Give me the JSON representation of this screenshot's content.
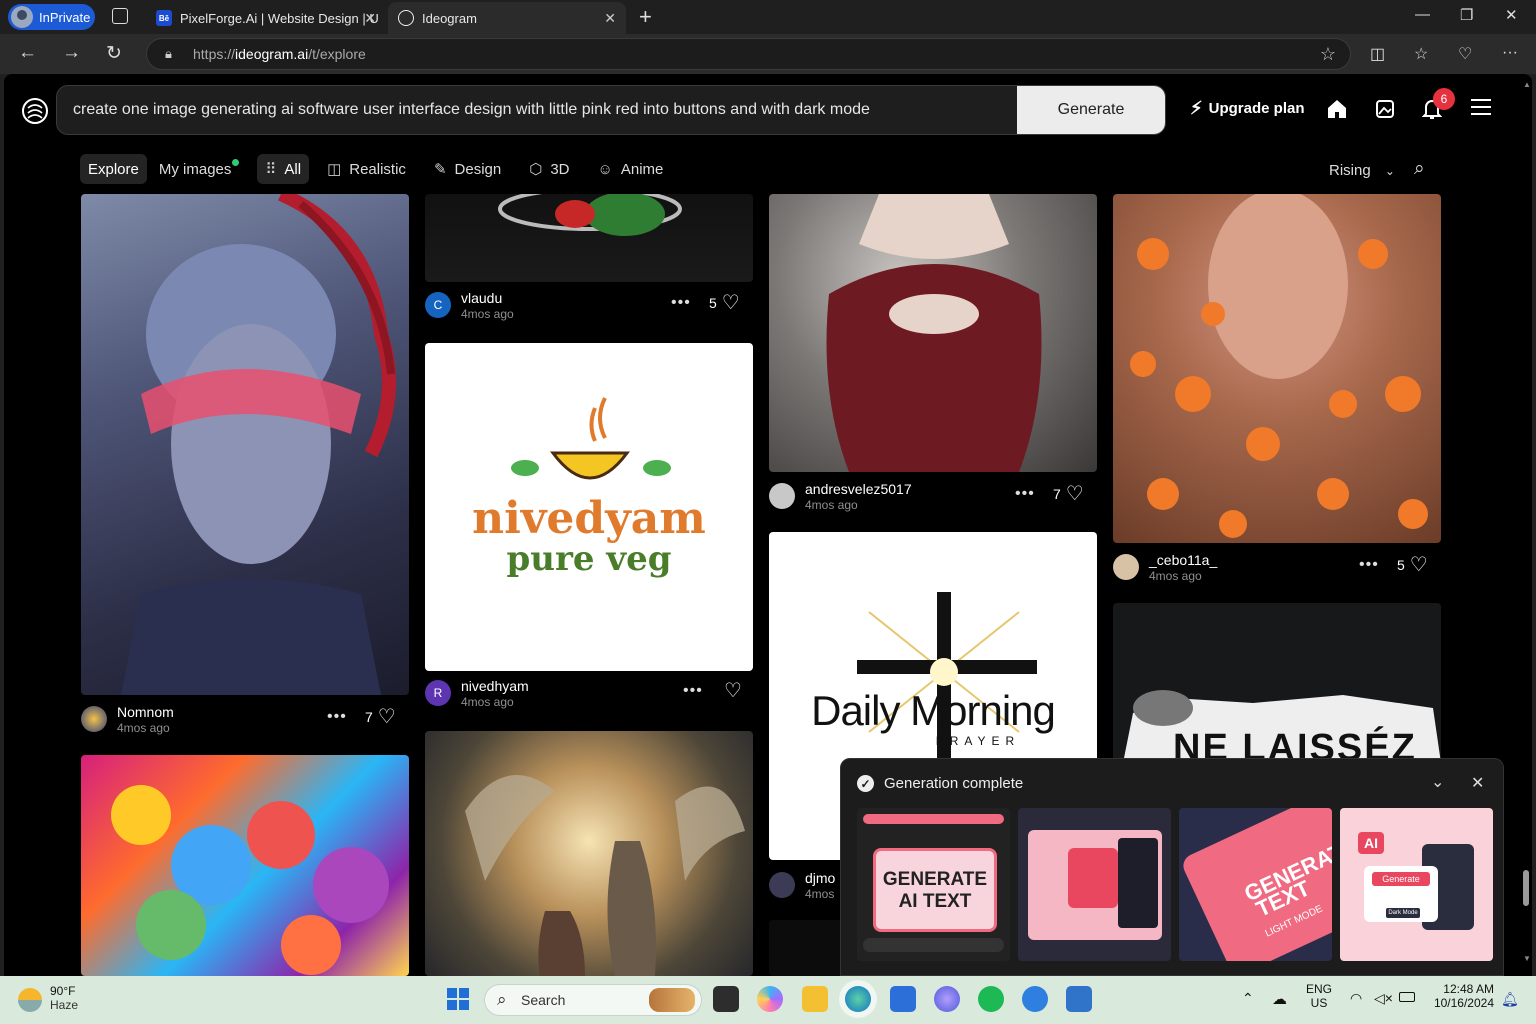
{
  "browser": {
    "inprivate_label": "InPrivate",
    "tabs": [
      {
        "title": "PixelForge.Ai | Website Design | U",
        "favicon": "Bē"
      },
      {
        "title": "Ideogram"
      }
    ],
    "url_prefix": "https://",
    "url_domain": "ideogram.ai",
    "url_path": "/t/explore"
  },
  "header": {
    "prompt_text": "create one image generating ai software user interface design with little pink red into buttons and with dark mode",
    "generate_label": "Generate",
    "upgrade_label": "Upgrade plan",
    "notification_count": "6"
  },
  "filters": {
    "explore": "Explore",
    "my_images": "My images",
    "all": "All",
    "realistic": "Realistic",
    "design": "Design",
    "threed": "3D",
    "anime": "Anime",
    "sort": "Rising"
  },
  "cards": [
    {
      "user": "Nomnom",
      "time": "4mos ago",
      "likes": "7"
    },
    {
      "user": "vlaudu",
      "time": "4mos ago",
      "likes": "5",
      "avatar": "C"
    },
    {
      "user": "nivedhyam",
      "time": "4mos ago",
      "likes": "",
      "avatar": "R"
    },
    {
      "user": "andresvelez5017",
      "time": "4mos ago",
      "likes": "7"
    },
    {
      "user": "djmo",
      "time": "4mos"
    },
    {
      "user": "_cebo11a_",
      "time": "4mos ago",
      "likes": "5"
    }
  ],
  "image_text": {
    "nivedyam_line1": "nivedyam",
    "nivedyam_line2": "pure veg",
    "daily": "Daily",
    "morning": "Morning",
    "prayer": "PRAYER",
    "ne_laissez": "NE LAISSÉZ"
  },
  "popup": {
    "title": "Generation complete",
    "thumb1_line1": "GENERATE",
    "thumb1_line2": "AI TEXT",
    "thumb3_line1": "GENERAT",
    "thumb3_line2": "TEXT",
    "thumb3_line3": "LIGHT MODE",
    "thumb4_ai": "AI",
    "thumb4_btn": "Generate",
    "thumb4_dark": "Dark Mode"
  },
  "taskbar": {
    "temp": "90°F",
    "condition": "Haze",
    "search_placeholder": "Search",
    "lang1": "ENG",
    "lang2": "US",
    "time": "12:48 AM",
    "date": "10/16/2024"
  },
  "colors": {
    "accent_pink": "#e8475f",
    "badge_red": "#e5323e",
    "inprivate_blue": "#1d5bd6"
  }
}
